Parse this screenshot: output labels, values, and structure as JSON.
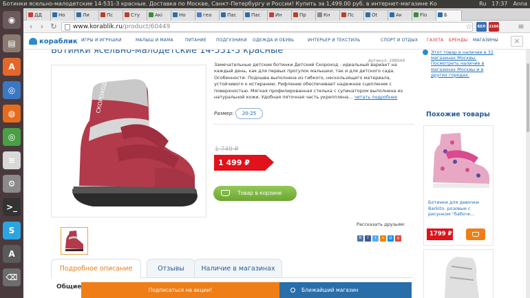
{
  "window": {
    "title": "Ботинки ясельно-малодетские 14-531-3 красные. Доставка по Москве, Санкт-Петербургу и России! Купить за 1,499.00 руб. в интернет-магазине Ко",
    "indicators": [
      "Ru",
      "17:37",
      "Anna"
    ]
  },
  "launcher": {
    "items": [
      {
        "name": "dash",
        "color": "#6c5a5c",
        "glyph": "◉"
      },
      {
        "name": "files",
        "color": "#8a7a70",
        "glyph": "▤"
      },
      {
        "name": "software-center",
        "color": "#e2682b",
        "glyph": "A"
      },
      {
        "name": "chromium",
        "color": "#3b78c4",
        "glyph": "◎"
      },
      {
        "name": "firefox",
        "color": "#e56c1d",
        "glyph": "◍"
      },
      {
        "name": "chrome",
        "color": "#4a9f45",
        "glyph": "◎"
      },
      {
        "name": "text-editor",
        "color": "#d8d8d8",
        "glyph": "≡"
      },
      {
        "name": "settings",
        "color": "#8a8a8a",
        "glyph": "⚙"
      },
      {
        "name": "terminal",
        "color": "#333333",
        "glyph": ">_"
      },
      {
        "name": "skype",
        "color": "#2aa5e1",
        "glyph": "S"
      },
      {
        "name": "updater",
        "color": "#5a5a5a",
        "glyph": "A"
      },
      {
        "name": "trash",
        "color": "#6c6c6c",
        "glyph": "⌫"
      }
    ]
  },
  "tabs": [
    {
      "label": "ДД",
      "favicon": "#cc3a3a"
    },
    {
      "label": "Но",
      "favicon": "#2a6ea9"
    },
    {
      "label": "Ли",
      "favicon": "#2a6ea9"
    },
    {
      "label": "Пс",
      "favicon": "#b7412a"
    },
    {
      "label": "Сту",
      "favicon": "#b7412a"
    },
    {
      "label": "Акі",
      "favicon": "#3b8c3b"
    },
    {
      "label": "Но",
      "favicon": "#2a6ea9"
    },
    {
      "label": "геа",
      "favicon": "#4a7bd0"
    },
    {
      "label": "Пас",
      "favicon": "#2a6ea9"
    },
    {
      "label": "Пас",
      "favicon": "#2a6ea9"
    },
    {
      "label": "Ин",
      "favicon": "#cc3a3a"
    },
    {
      "label": "Пр",
      "favicon": "#b7412a"
    },
    {
      "label": "Кн",
      "favicon": "#8a8a8a"
    },
    {
      "label": "Пс",
      "favicon": "#b7412a"
    },
    {
      "label": "Ot",
      "favicon": "#2a6ea9"
    },
    {
      "label": "Ак",
      "favicon": "#2a6ea9"
    },
    {
      "label": "Flo",
      "favicon": "#3b8c3b"
    },
    {
      "label": "Б",
      "favicon": "#2a6ea9",
      "active": true
    }
  ],
  "toolbar": {
    "back": "‹",
    "forward": "›",
    "reload": "↻",
    "url_host": "www.korablik.ru",
    "url_path": "/product/60449",
    "star": "☆",
    "menu": "≡",
    "ext1": "БЕЛ",
    "ext2": "2166",
    "ext1_color": "#3a6fb0",
    "ext2_color": "#c0282d"
  },
  "site": {
    "logo": "кораблик",
    "nav": [
      {
        "label": "ИГРЫ И ИГРУШКИ"
      },
      {
        "label": "МАЛЫШ И МАМА"
      },
      {
        "label": "ПИТАНИЕ"
      },
      {
        "label": "ПОДГУЗНИКИ"
      },
      {
        "label": "ОДЕЖДА И ОБУВЬ"
      },
      {
        "label": "ИНТЕРЬЕР И ТЕКСТИЛЬ"
      },
      {
        "label": "СПОРТ И ОТДЫХ"
      },
      {
        "label": "ГАЗЕТА",
        "red": true
      },
      {
        "label": "БРЕНДЫ",
        "red": true
      },
      {
        "label": "МАГАЗИНЫ"
      }
    ],
    "close": "×"
  },
  "product": {
    "title": "Ботинки ясельно-малодетские 14-531-3 красные",
    "article": "Артикул: 298949",
    "description": "Замечательные детские ботинки Детский Скороход - идеальный вариант на каждый день, как для первых прогулок малышки, так и для детского сада. Особенности: Подошва выполнена из гибкого, нескользящего материала, устойчивого к истиранию. Рифление обеспечивает надежное сцепление с поверхностью. Мягкая профилированная стелька с супинатором выполнена из натуральной кожи. Удобная пяточная часть укрепплена…",
    "read_more": "читать подробнее",
    "size_label": "Размер:",
    "size_value": "20-25",
    "old_price": "1 749 ₽",
    "new_price": "1 499 ₽",
    "cart_button": "Товар в корзине",
    "share_label": "Рассказать друзьям:",
    "share_icons": [
      {
        "name": "vk",
        "color": "#4a76a8",
        "glyph": "В"
      },
      {
        "name": "facebook",
        "color": "#3b5998",
        "glyph": "f"
      },
      {
        "name": "twitter",
        "color": "#55acee",
        "glyph": "t"
      },
      {
        "name": "odnoklassniki",
        "color": "#ee8208",
        "glyph": "о"
      },
      {
        "name": "moimir",
        "color": "#168de2",
        "glyph": "@"
      },
      {
        "name": "gplus",
        "color": "#dd4b39",
        "glyph": "g"
      }
    ],
    "tabs": [
      {
        "label": "Подробное описание",
        "active": true
      },
      {
        "label": "Отзывы"
      },
      {
        "label": "Наличие в магазинах"
      }
    ],
    "general_heading": "Общие"
  },
  "sidebar": {
    "availability_text": "Этот товар в наличии в 32 магазинах Москвы.",
    "availability_link": "Посмотреть наличие в магазинах Москвы и в других городах.",
    "similar_heading": "Похожие товары",
    "similar": [
      {
        "name": "Ботинки для девочки Barkito, розовые с рисунком \"бабочк...",
        "price": "1799 ₽"
      }
    ]
  },
  "bottom": {
    "subscribe": "Подписаться на акции!",
    "nearest": "Ближайший магазин"
  },
  "colors": {
    "accent_blue": "#245b9a",
    "price_red": "#e0121b",
    "cart_green": "#6da632",
    "orange": "#ef7e17"
  }
}
